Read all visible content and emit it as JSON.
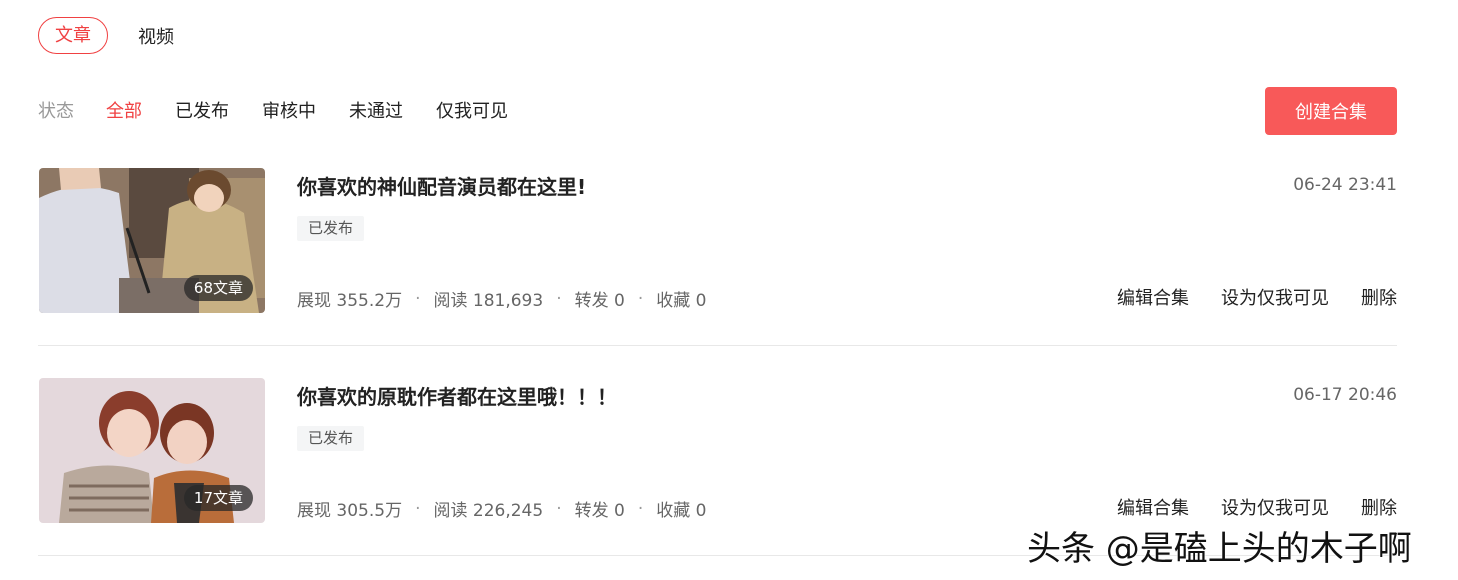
{
  "tabs": [
    {
      "label": "文章",
      "active": true
    },
    {
      "label": "视频",
      "active": false
    }
  ],
  "filter": {
    "label": "状态",
    "options": [
      "全部",
      "已发布",
      "审核中",
      "未通过",
      "仅我可见"
    ],
    "active_index": 0
  },
  "create_button": "创建合集",
  "collections": [
    {
      "title": "你喜欢的神仙配音演员都在这里!",
      "time": "06-24 23:41",
      "status": "已发布",
      "count": "68文章",
      "stats": [
        "展现 355.2万",
        "阅读 181,693",
        "转发 0",
        "收藏 0"
      ],
      "actions": [
        "编辑合集",
        "设为仅我可见",
        "删除"
      ]
    },
    {
      "title": "你喜欢的原耽作者都在这里哦！！！",
      "time": "06-17 20:46",
      "status": "已发布",
      "count": "17文章",
      "stats": [
        "展现 305.5万",
        "阅读 226,245",
        "转发 0",
        "收藏 0"
      ],
      "actions": [
        "编辑合集",
        "设为仅我可见",
        "删除"
      ]
    }
  ],
  "watermark": "头条 @是磕上头的木子啊",
  "colors": {
    "accent": "#f04142",
    "button": "#f85959"
  },
  "stat_separator": "·"
}
